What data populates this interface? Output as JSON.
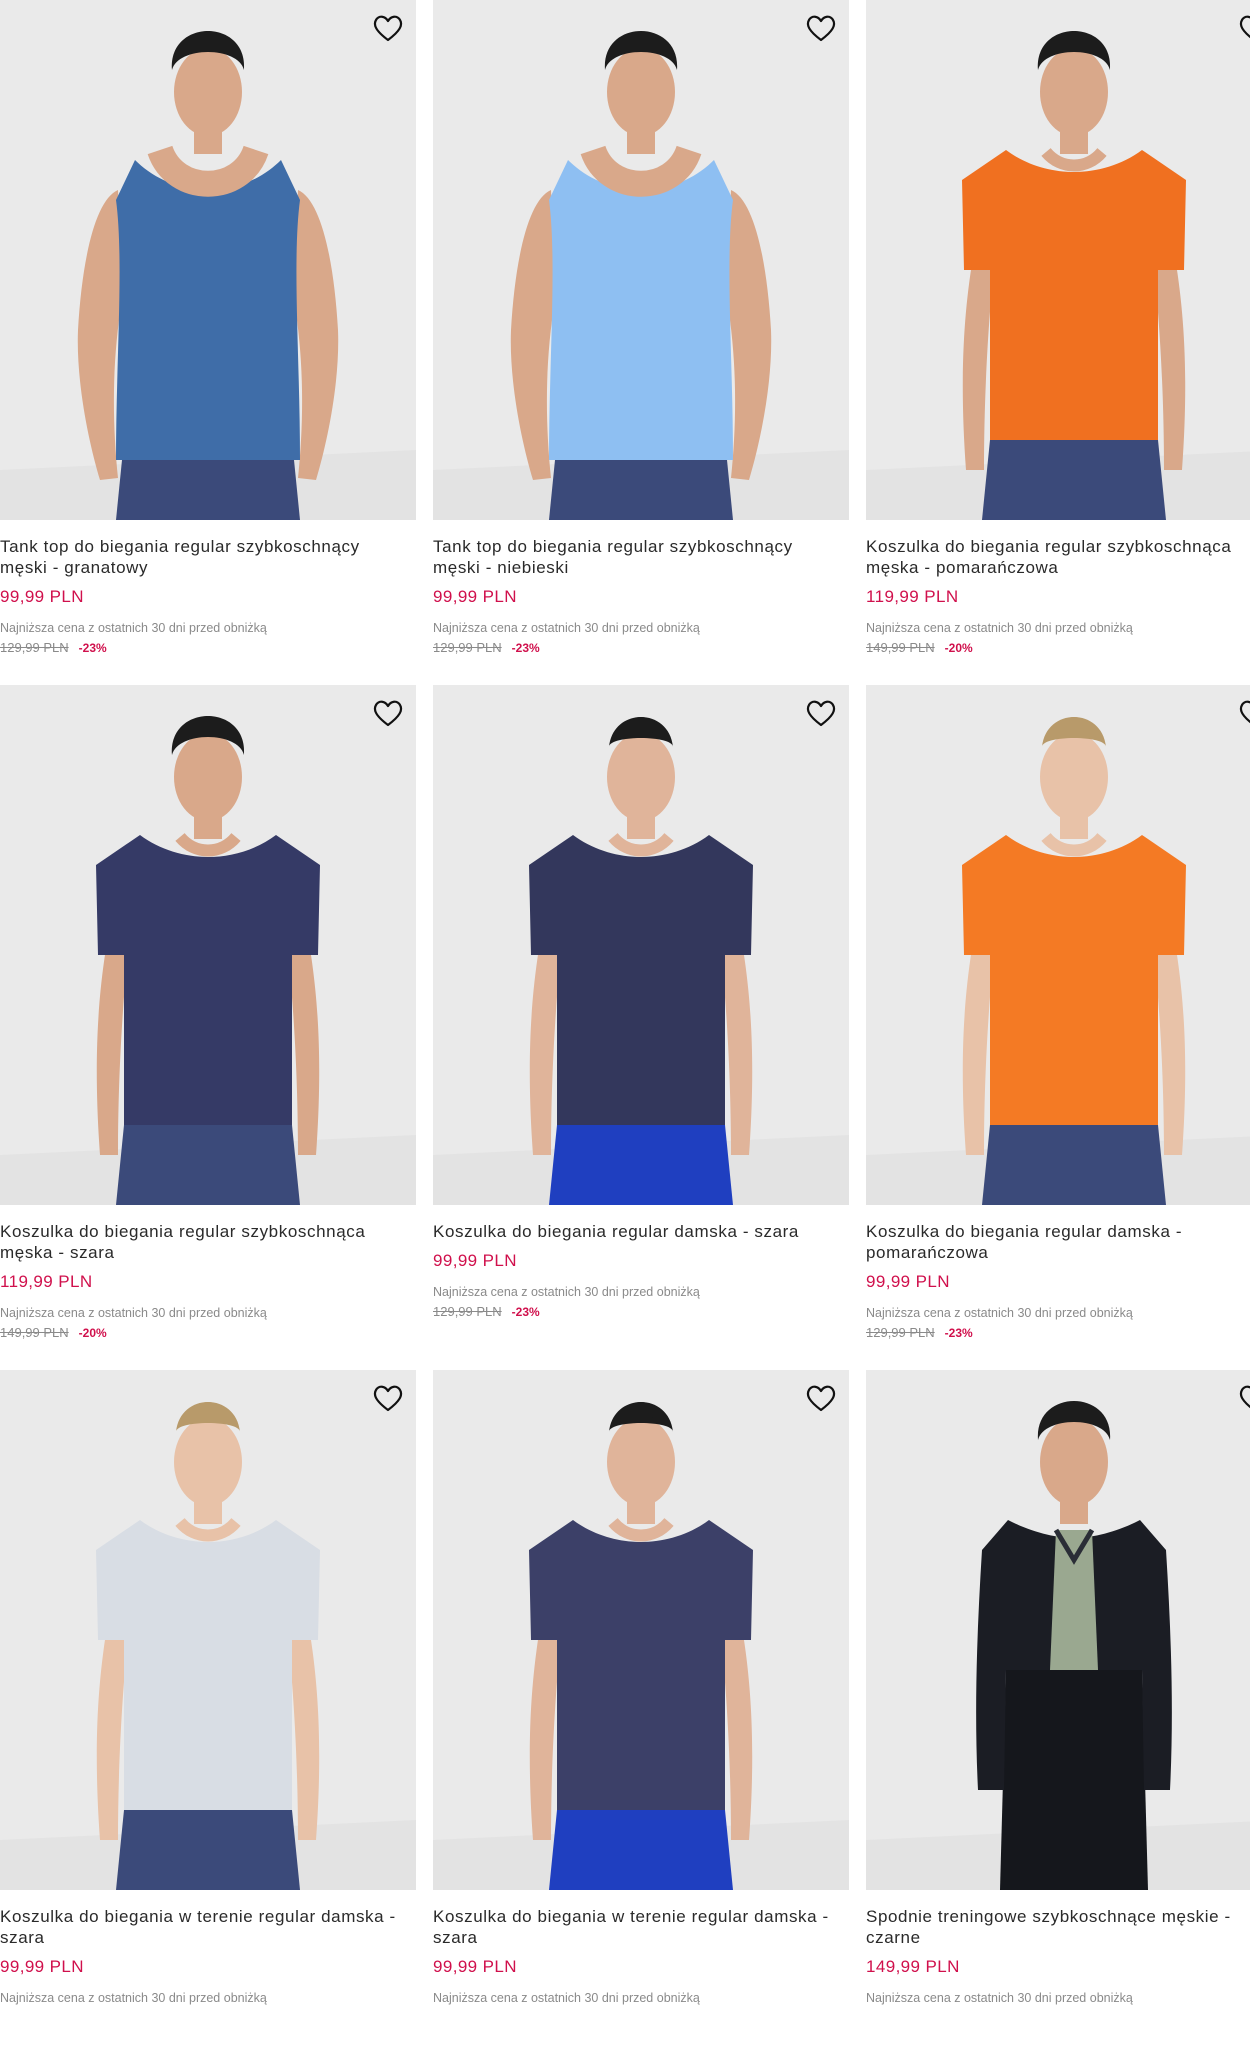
{
  "colors": {
    "price": "#d0104c",
    "muted": "#8a8a8a",
    "bg_photo": "#e9e9e9"
  },
  "products": [
    {
      "title": "Tank top do biegania regular szybkoschnący męski - granatowy",
      "price": "99,99 PLN",
      "lowest_label": "Najniższa cena z ostatnich 30 dni przed obniżką",
      "old_price": "129,99 PLN",
      "discount": "-23%",
      "garment_color": "#3f6da8",
      "garment": "tank",
      "pants": "#3b4a7a",
      "skin": "#d9a88a",
      "hair": "#1c1c1c",
      "sex": "m"
    },
    {
      "title": "Tank top do biegania regular szybkoschnący męski - niebieski",
      "price": "99,99 PLN",
      "lowest_label": "Najniższa cena z ostatnich 30 dni przed obniżką",
      "old_price": "129,99 PLN",
      "discount": "-23%",
      "garment_color": "#8ebff2",
      "garment": "tank",
      "pants": "#3b4a7a",
      "skin": "#d9a88a",
      "hair": "#1c1c1c",
      "sex": "m"
    },
    {
      "title": "Koszulka do biegania regular szybkoschnąca męska - pomarańczowa",
      "price": "119,99 PLN",
      "lowest_label": "Najniższa cena z ostatnich 30 dni przed obniżką",
      "old_price": "149,99 PLN",
      "discount": "-20%",
      "garment_color": "#f07020",
      "garment": "tee",
      "pants": "#3b4a7a",
      "skin": "#d9a88a",
      "hair": "#1c1c1c",
      "sex": "m"
    },
    {
      "title": "Koszulka do biegania regular szybkoschnąca męska - szara",
      "price": "119,99 PLN",
      "lowest_label": "Najniższa cena z ostatnich 30 dni przed obniżką",
      "old_price": "149,99 PLN",
      "discount": "-20%",
      "garment_color": "#353a66",
      "garment": "tee",
      "pants": "#3b4a7a",
      "skin": "#d9a88a",
      "hair": "#1c1c1c",
      "sex": "m"
    },
    {
      "title": "Koszulka do biegania regular damska - szara",
      "price": "99,99 PLN",
      "lowest_label": "Najniższa cena z ostatnich 30 dni przed obniżką",
      "old_price": "129,99 PLN",
      "discount": "-23%",
      "garment_color": "#33375c",
      "garment": "tee",
      "pants": "#1f3fc0",
      "skin": "#e0b49a",
      "hair": "#1c1c1c",
      "sex": "f"
    },
    {
      "title": "Koszulka do biegania regular damska - pomarańczowa",
      "price": "99,99 PLN",
      "lowest_label": "Najniższa cena z ostatnich 30 dni przed obniżką",
      "old_price": "129,99 PLN",
      "discount": "-23%",
      "garment_color": "#f47a24",
      "garment": "tee",
      "pants": "#3b4a7a",
      "skin": "#e8c2a8",
      "hair": "#b89a6a",
      "sex": "f"
    },
    {
      "title": "Koszulka do biegania w terenie regular damska - szara",
      "price": "99,99 PLN",
      "lowest_label": "Najniższa cena z ostatnich 30 dni przed obniżką",
      "old_price": "",
      "discount": "",
      "garment_color": "#d8dde4",
      "garment": "tee",
      "pants": "#3b4a7a",
      "skin": "#e8c2a8",
      "hair": "#b89a6a",
      "sex": "f"
    },
    {
      "title": "Koszulka do biegania w terenie regular damska - szara",
      "price": "99,99 PLN",
      "lowest_label": "Najniższa cena z ostatnich 30 dni przed obniżką",
      "old_price": "",
      "discount": "",
      "garment_color": "#3c4068",
      "garment": "tee",
      "pants": "#1f3fc0",
      "skin": "#e0b49a",
      "hair": "#1c1c1c",
      "sex": "f"
    },
    {
      "title": "Spodnie treningowe szybkoschnące męskie - czarne",
      "price": "149,99 PLN",
      "lowest_label": "Najniższa cena z ostatnich 30 dni przed obniżką",
      "old_price": "",
      "discount": "",
      "garment_color": "#1b1d24",
      "garment": "jacket",
      "pants": "#15171c",
      "skin": "#d9a88a",
      "hair": "#1c1c1c",
      "sex": "m"
    }
  ],
  "icons": {
    "favorite": "heart-outline-icon"
  }
}
